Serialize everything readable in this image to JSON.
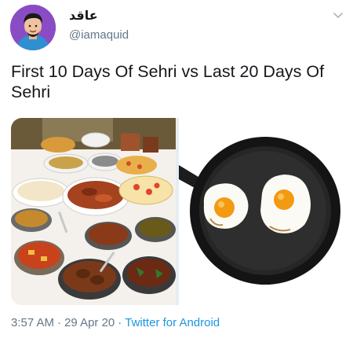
{
  "author": {
    "display_name": "عاقد",
    "handle": "@iamaquid",
    "avatar_icon": "avatar-cartoon-icon"
  },
  "menu": {
    "icon": "chevron-down-icon"
  },
  "tweet": {
    "text": "First 10 Days Of Sehri vs Last 20 Days Of Sehri"
  },
  "media": {
    "images": [
      {
        "name": "sehri-feast-photo",
        "icon": "food-spread-image"
      },
      {
        "name": "fried-eggs-photo",
        "icon": "fried-eggs-pan-image"
      }
    ]
  },
  "meta": {
    "time": "3:57 AM",
    "date": "29 Apr 20",
    "separator": "·",
    "source": "Twitter for Android"
  },
  "colors": {
    "text": "#14171a",
    "secondary": "#657786",
    "link": "#1b95e0"
  }
}
